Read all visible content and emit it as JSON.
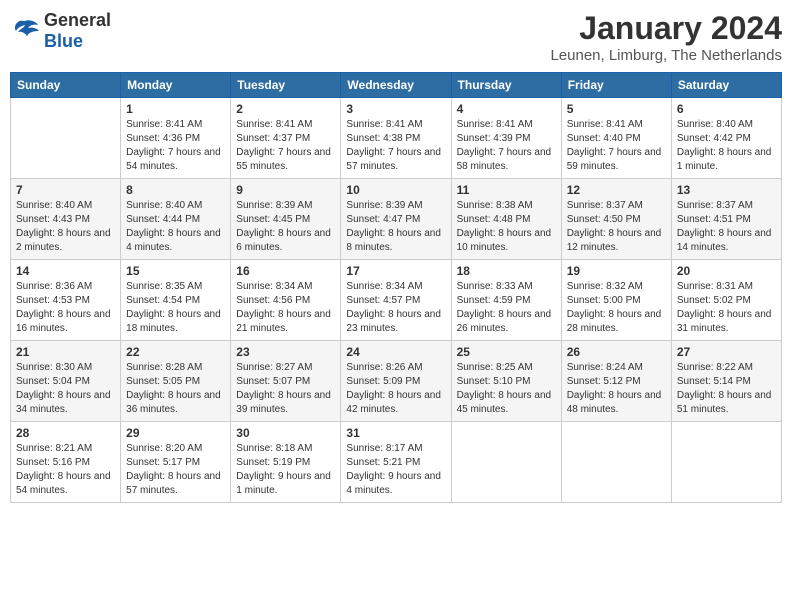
{
  "logo": {
    "general": "General",
    "blue": "Blue"
  },
  "title": "January 2024",
  "location": "Leunen, Limburg, The Netherlands",
  "days_of_week": [
    "Sunday",
    "Monday",
    "Tuesday",
    "Wednesday",
    "Thursday",
    "Friday",
    "Saturday"
  ],
  "weeks": [
    [
      {
        "day": "",
        "sunrise": "",
        "sunset": "",
        "daylight": ""
      },
      {
        "day": "1",
        "sunrise": "Sunrise: 8:41 AM",
        "sunset": "Sunset: 4:36 PM",
        "daylight": "Daylight: 7 hours and 54 minutes."
      },
      {
        "day": "2",
        "sunrise": "Sunrise: 8:41 AM",
        "sunset": "Sunset: 4:37 PM",
        "daylight": "Daylight: 7 hours and 55 minutes."
      },
      {
        "day": "3",
        "sunrise": "Sunrise: 8:41 AM",
        "sunset": "Sunset: 4:38 PM",
        "daylight": "Daylight: 7 hours and 57 minutes."
      },
      {
        "day": "4",
        "sunrise": "Sunrise: 8:41 AM",
        "sunset": "Sunset: 4:39 PM",
        "daylight": "Daylight: 7 hours and 58 minutes."
      },
      {
        "day": "5",
        "sunrise": "Sunrise: 8:41 AM",
        "sunset": "Sunset: 4:40 PM",
        "daylight": "Daylight: 7 hours and 59 minutes."
      },
      {
        "day": "6",
        "sunrise": "Sunrise: 8:40 AM",
        "sunset": "Sunset: 4:42 PM",
        "daylight": "Daylight: 8 hours and 1 minute."
      }
    ],
    [
      {
        "day": "7",
        "sunrise": "Sunrise: 8:40 AM",
        "sunset": "Sunset: 4:43 PM",
        "daylight": "Daylight: 8 hours and 2 minutes."
      },
      {
        "day": "8",
        "sunrise": "Sunrise: 8:40 AM",
        "sunset": "Sunset: 4:44 PM",
        "daylight": "Daylight: 8 hours and 4 minutes."
      },
      {
        "day": "9",
        "sunrise": "Sunrise: 8:39 AM",
        "sunset": "Sunset: 4:45 PM",
        "daylight": "Daylight: 8 hours and 6 minutes."
      },
      {
        "day": "10",
        "sunrise": "Sunrise: 8:39 AM",
        "sunset": "Sunset: 4:47 PM",
        "daylight": "Daylight: 8 hours and 8 minutes."
      },
      {
        "day": "11",
        "sunrise": "Sunrise: 8:38 AM",
        "sunset": "Sunset: 4:48 PM",
        "daylight": "Daylight: 8 hours and 10 minutes."
      },
      {
        "day": "12",
        "sunrise": "Sunrise: 8:37 AM",
        "sunset": "Sunset: 4:50 PM",
        "daylight": "Daylight: 8 hours and 12 minutes."
      },
      {
        "day": "13",
        "sunrise": "Sunrise: 8:37 AM",
        "sunset": "Sunset: 4:51 PM",
        "daylight": "Daylight: 8 hours and 14 minutes."
      }
    ],
    [
      {
        "day": "14",
        "sunrise": "Sunrise: 8:36 AM",
        "sunset": "Sunset: 4:53 PM",
        "daylight": "Daylight: 8 hours and 16 minutes."
      },
      {
        "day": "15",
        "sunrise": "Sunrise: 8:35 AM",
        "sunset": "Sunset: 4:54 PM",
        "daylight": "Daylight: 8 hours and 18 minutes."
      },
      {
        "day": "16",
        "sunrise": "Sunrise: 8:34 AM",
        "sunset": "Sunset: 4:56 PM",
        "daylight": "Daylight: 8 hours and 21 minutes."
      },
      {
        "day": "17",
        "sunrise": "Sunrise: 8:34 AM",
        "sunset": "Sunset: 4:57 PM",
        "daylight": "Daylight: 8 hours and 23 minutes."
      },
      {
        "day": "18",
        "sunrise": "Sunrise: 8:33 AM",
        "sunset": "Sunset: 4:59 PM",
        "daylight": "Daylight: 8 hours and 26 minutes."
      },
      {
        "day": "19",
        "sunrise": "Sunrise: 8:32 AM",
        "sunset": "Sunset: 5:00 PM",
        "daylight": "Daylight: 8 hours and 28 minutes."
      },
      {
        "day": "20",
        "sunrise": "Sunrise: 8:31 AM",
        "sunset": "Sunset: 5:02 PM",
        "daylight": "Daylight: 8 hours and 31 minutes."
      }
    ],
    [
      {
        "day": "21",
        "sunrise": "Sunrise: 8:30 AM",
        "sunset": "Sunset: 5:04 PM",
        "daylight": "Daylight: 8 hours and 34 minutes."
      },
      {
        "day": "22",
        "sunrise": "Sunrise: 8:28 AM",
        "sunset": "Sunset: 5:05 PM",
        "daylight": "Daylight: 8 hours and 36 minutes."
      },
      {
        "day": "23",
        "sunrise": "Sunrise: 8:27 AM",
        "sunset": "Sunset: 5:07 PM",
        "daylight": "Daylight: 8 hours and 39 minutes."
      },
      {
        "day": "24",
        "sunrise": "Sunrise: 8:26 AM",
        "sunset": "Sunset: 5:09 PM",
        "daylight": "Daylight: 8 hours and 42 minutes."
      },
      {
        "day": "25",
        "sunrise": "Sunrise: 8:25 AM",
        "sunset": "Sunset: 5:10 PM",
        "daylight": "Daylight: 8 hours and 45 minutes."
      },
      {
        "day": "26",
        "sunrise": "Sunrise: 8:24 AM",
        "sunset": "Sunset: 5:12 PM",
        "daylight": "Daylight: 8 hours and 48 minutes."
      },
      {
        "day": "27",
        "sunrise": "Sunrise: 8:22 AM",
        "sunset": "Sunset: 5:14 PM",
        "daylight": "Daylight: 8 hours and 51 minutes."
      }
    ],
    [
      {
        "day": "28",
        "sunrise": "Sunrise: 8:21 AM",
        "sunset": "Sunset: 5:16 PM",
        "daylight": "Daylight: 8 hours and 54 minutes."
      },
      {
        "day": "29",
        "sunrise": "Sunrise: 8:20 AM",
        "sunset": "Sunset: 5:17 PM",
        "daylight": "Daylight: 8 hours and 57 minutes."
      },
      {
        "day": "30",
        "sunrise": "Sunrise: 8:18 AM",
        "sunset": "Sunset: 5:19 PM",
        "daylight": "Daylight: 9 hours and 1 minute."
      },
      {
        "day": "31",
        "sunrise": "Sunrise: 8:17 AM",
        "sunset": "Sunset: 5:21 PM",
        "daylight": "Daylight: 9 hours and 4 minutes."
      },
      {
        "day": "",
        "sunrise": "",
        "sunset": "",
        "daylight": ""
      },
      {
        "day": "",
        "sunrise": "",
        "sunset": "",
        "daylight": ""
      },
      {
        "day": "",
        "sunrise": "",
        "sunset": "",
        "daylight": ""
      }
    ]
  ]
}
